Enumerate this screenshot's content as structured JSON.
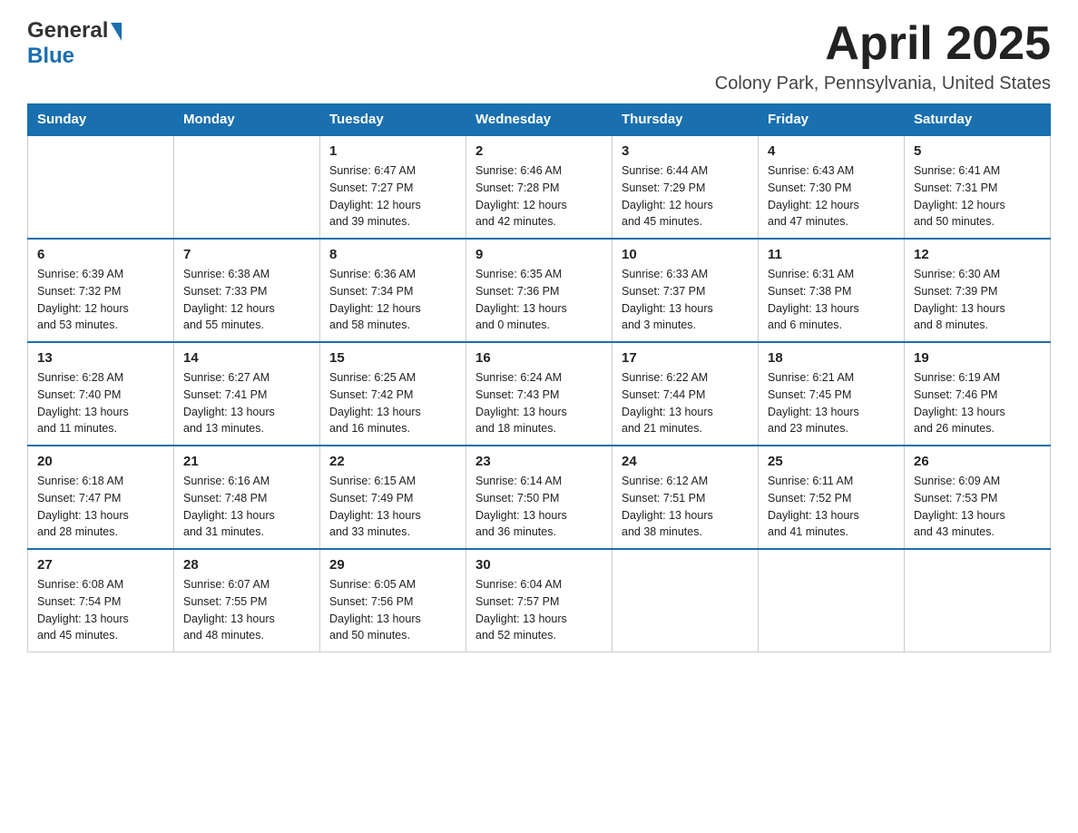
{
  "header": {
    "logo_general": "General",
    "logo_blue": "Blue",
    "month_title": "April 2025",
    "location": "Colony Park, Pennsylvania, United States"
  },
  "days_of_week": [
    "Sunday",
    "Monday",
    "Tuesday",
    "Wednesday",
    "Thursday",
    "Friday",
    "Saturday"
  ],
  "weeks": [
    [
      {
        "day": "",
        "info": ""
      },
      {
        "day": "",
        "info": ""
      },
      {
        "day": "1",
        "info": "Sunrise: 6:47 AM\nSunset: 7:27 PM\nDaylight: 12 hours\nand 39 minutes."
      },
      {
        "day": "2",
        "info": "Sunrise: 6:46 AM\nSunset: 7:28 PM\nDaylight: 12 hours\nand 42 minutes."
      },
      {
        "day": "3",
        "info": "Sunrise: 6:44 AM\nSunset: 7:29 PM\nDaylight: 12 hours\nand 45 minutes."
      },
      {
        "day": "4",
        "info": "Sunrise: 6:43 AM\nSunset: 7:30 PM\nDaylight: 12 hours\nand 47 minutes."
      },
      {
        "day": "5",
        "info": "Sunrise: 6:41 AM\nSunset: 7:31 PM\nDaylight: 12 hours\nand 50 minutes."
      }
    ],
    [
      {
        "day": "6",
        "info": "Sunrise: 6:39 AM\nSunset: 7:32 PM\nDaylight: 12 hours\nand 53 minutes."
      },
      {
        "day": "7",
        "info": "Sunrise: 6:38 AM\nSunset: 7:33 PM\nDaylight: 12 hours\nand 55 minutes."
      },
      {
        "day": "8",
        "info": "Sunrise: 6:36 AM\nSunset: 7:34 PM\nDaylight: 12 hours\nand 58 minutes."
      },
      {
        "day": "9",
        "info": "Sunrise: 6:35 AM\nSunset: 7:36 PM\nDaylight: 13 hours\nand 0 minutes."
      },
      {
        "day": "10",
        "info": "Sunrise: 6:33 AM\nSunset: 7:37 PM\nDaylight: 13 hours\nand 3 minutes."
      },
      {
        "day": "11",
        "info": "Sunrise: 6:31 AM\nSunset: 7:38 PM\nDaylight: 13 hours\nand 6 minutes."
      },
      {
        "day": "12",
        "info": "Sunrise: 6:30 AM\nSunset: 7:39 PM\nDaylight: 13 hours\nand 8 minutes."
      }
    ],
    [
      {
        "day": "13",
        "info": "Sunrise: 6:28 AM\nSunset: 7:40 PM\nDaylight: 13 hours\nand 11 minutes."
      },
      {
        "day": "14",
        "info": "Sunrise: 6:27 AM\nSunset: 7:41 PM\nDaylight: 13 hours\nand 13 minutes."
      },
      {
        "day": "15",
        "info": "Sunrise: 6:25 AM\nSunset: 7:42 PM\nDaylight: 13 hours\nand 16 minutes."
      },
      {
        "day": "16",
        "info": "Sunrise: 6:24 AM\nSunset: 7:43 PM\nDaylight: 13 hours\nand 18 minutes."
      },
      {
        "day": "17",
        "info": "Sunrise: 6:22 AM\nSunset: 7:44 PM\nDaylight: 13 hours\nand 21 minutes."
      },
      {
        "day": "18",
        "info": "Sunrise: 6:21 AM\nSunset: 7:45 PM\nDaylight: 13 hours\nand 23 minutes."
      },
      {
        "day": "19",
        "info": "Sunrise: 6:19 AM\nSunset: 7:46 PM\nDaylight: 13 hours\nand 26 minutes."
      }
    ],
    [
      {
        "day": "20",
        "info": "Sunrise: 6:18 AM\nSunset: 7:47 PM\nDaylight: 13 hours\nand 28 minutes."
      },
      {
        "day": "21",
        "info": "Sunrise: 6:16 AM\nSunset: 7:48 PM\nDaylight: 13 hours\nand 31 minutes."
      },
      {
        "day": "22",
        "info": "Sunrise: 6:15 AM\nSunset: 7:49 PM\nDaylight: 13 hours\nand 33 minutes."
      },
      {
        "day": "23",
        "info": "Sunrise: 6:14 AM\nSunset: 7:50 PM\nDaylight: 13 hours\nand 36 minutes."
      },
      {
        "day": "24",
        "info": "Sunrise: 6:12 AM\nSunset: 7:51 PM\nDaylight: 13 hours\nand 38 minutes."
      },
      {
        "day": "25",
        "info": "Sunrise: 6:11 AM\nSunset: 7:52 PM\nDaylight: 13 hours\nand 41 minutes."
      },
      {
        "day": "26",
        "info": "Sunrise: 6:09 AM\nSunset: 7:53 PM\nDaylight: 13 hours\nand 43 minutes."
      }
    ],
    [
      {
        "day": "27",
        "info": "Sunrise: 6:08 AM\nSunset: 7:54 PM\nDaylight: 13 hours\nand 45 minutes."
      },
      {
        "day": "28",
        "info": "Sunrise: 6:07 AM\nSunset: 7:55 PM\nDaylight: 13 hours\nand 48 minutes."
      },
      {
        "day": "29",
        "info": "Sunrise: 6:05 AM\nSunset: 7:56 PM\nDaylight: 13 hours\nand 50 minutes."
      },
      {
        "day": "30",
        "info": "Sunrise: 6:04 AM\nSunset: 7:57 PM\nDaylight: 13 hours\nand 52 minutes."
      },
      {
        "day": "",
        "info": ""
      },
      {
        "day": "",
        "info": ""
      },
      {
        "day": "",
        "info": ""
      }
    ]
  ]
}
